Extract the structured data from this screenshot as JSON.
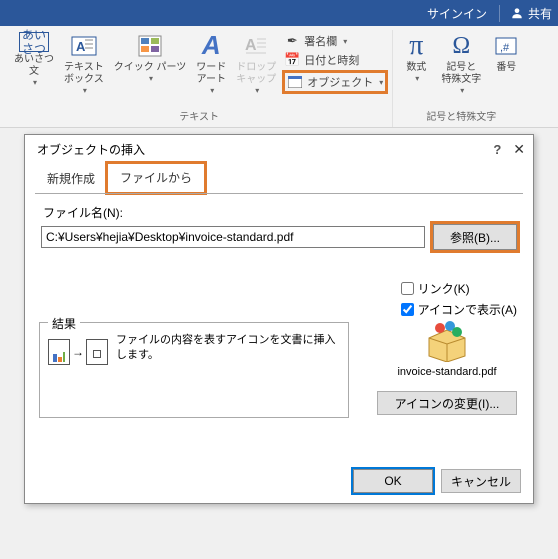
{
  "titlebar": {
    "signin": "サインイン",
    "share": "共有"
  },
  "ribbon": {
    "group_text": "テキスト",
    "group_symbols": "記号と特殊文字",
    "btns": {
      "aisatsu": "あいさつ\n文",
      "textbox": "テキスト\nボックス",
      "quickparts": "クイック パーツ",
      "wordart": "ワード\nアート",
      "dropcap": "ドロップ\nキャップ",
      "signature": "署名欄",
      "datetime": "日付と時刻",
      "object": "オブジェクト",
      "equation": "数式",
      "symbol": "記号と\n特殊文字",
      "number": "番号"
    }
  },
  "dialog": {
    "title": "オブジェクトの挿入",
    "tab_new": "新規作成",
    "tab_file": "ファイルから",
    "file_label": "ファイル名(N):",
    "file_value": "C:¥Users¥hejia¥Desktop¥invoice-standard.pdf",
    "browse": "参照(B)...",
    "link": "リンク(K)",
    "icon_display": "アイコンで表示(A)",
    "result_legend": "結果",
    "result_desc": "ファイルの内容を表すアイコンを文書に挿入します。",
    "preview_name": "invoice-standard.pdf",
    "change_icon": "アイコンの変更(I)...",
    "ok": "OK",
    "cancel": "キャンセル"
  }
}
